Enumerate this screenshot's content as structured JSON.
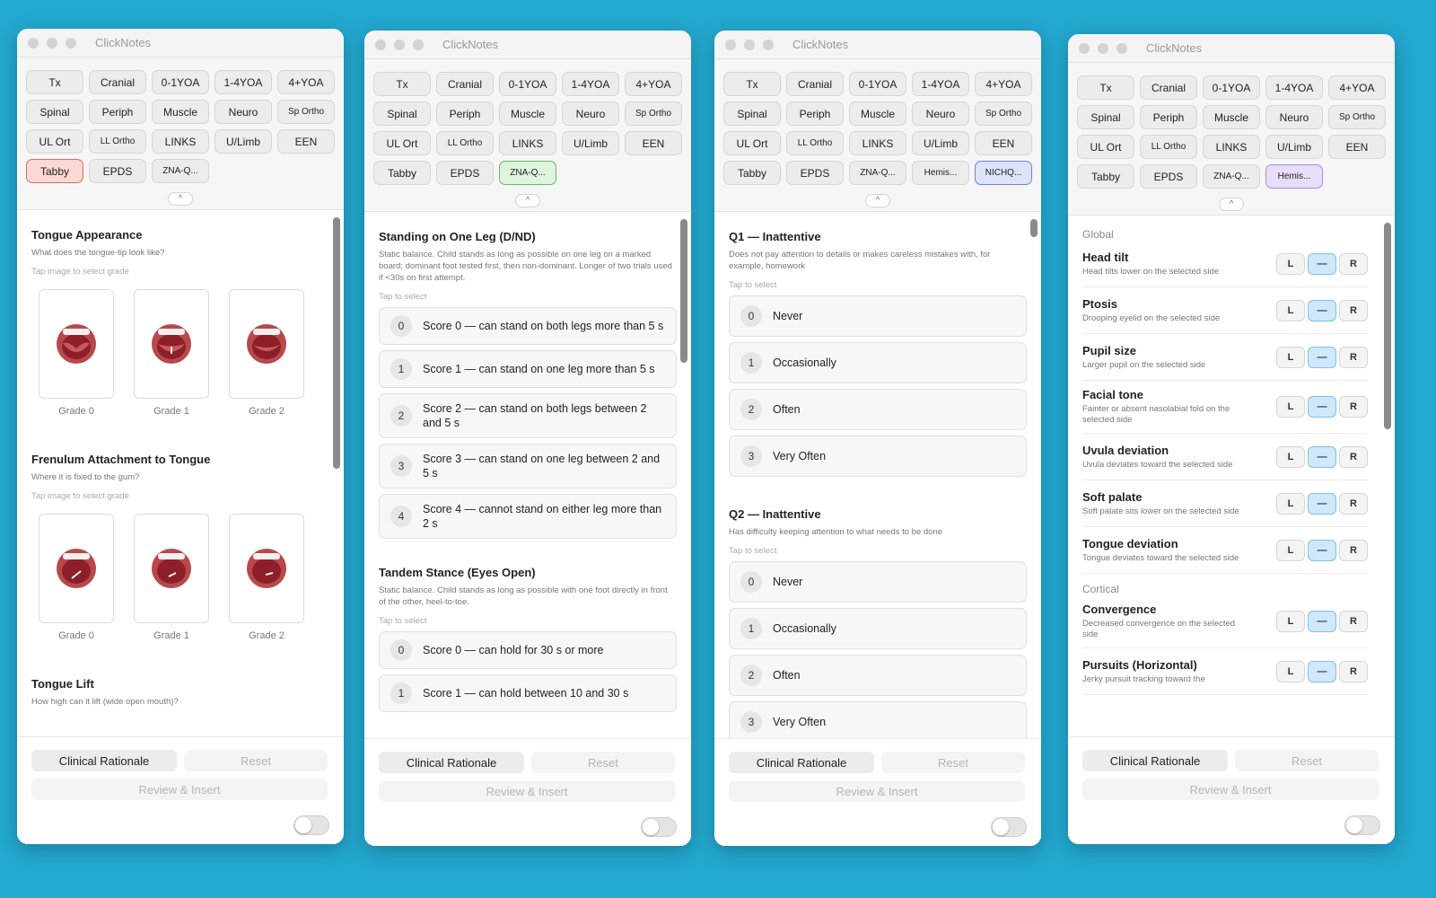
{
  "app_title": "ClickNotes",
  "windows": [
    {
      "tabs": [
        "Tx",
        "Cranial",
        "0-1YOA",
        "1-4YOA",
        "4+YOA",
        "Spinal",
        "Periph",
        "Muscle",
        "Neuro",
        "Sp Ortho",
        "UL Ort",
        "LL Ortho",
        "LINKS",
        "U/Limb",
        "EEN",
        "Tabby",
        "EPDS",
        "ZNA-Q..."
      ],
      "active_tab": "Tabby",
      "sections": [
        {
          "title": "Tongue Appearance",
          "desc": "What does the tongue-tip look like?",
          "tap": "Tap image to select grade",
          "grades": [
            "Grade 0",
            "Grade 1",
            "Grade 2"
          ]
        },
        {
          "title": "Frenulum Attachment to Tongue",
          "desc": "Where it is fixed to the gum?",
          "tap": "Tap image to select grade",
          "grades": [
            "Grade 0",
            "Grade 1",
            "Grade 2"
          ]
        },
        {
          "title": "Tongue Lift",
          "desc": "How high can it lift (wide open mouth)?"
        }
      ]
    },
    {
      "tabs": [
        "Tx",
        "Cranial",
        "0-1YOA",
        "1-4YOA",
        "4+YOA",
        "Spinal",
        "Periph",
        "Muscle",
        "Neuro",
        "Sp Ortho",
        "UL Ort",
        "LL Ortho",
        "LINKS",
        "U/Limb",
        "EEN",
        "Tabby",
        "EPDS",
        "ZNA-Q..."
      ],
      "active_tab": "ZNA-Q...",
      "sections": [
        {
          "title": "Standing on One Leg (D/ND)",
          "desc": "Static balance. Child stands as long as possible on one leg on a marked board; dominant foot tested first, then non-dominant. Longer of two trials used if <30s on first attempt.",
          "tap": "Tap to select",
          "options": [
            {
              "num": "0",
              "text": "Score 0 — can stand on both legs more than 5 s"
            },
            {
              "num": "1",
              "text": "Score 1 — can stand on one leg more than 5 s"
            },
            {
              "num": "2",
              "text": "Score 2 — can stand on both legs between 2 and 5 s"
            },
            {
              "num": "3",
              "text": "Score 3 — can stand on one leg between 2 and 5 s"
            },
            {
              "num": "4",
              "text": "Score 4 — cannot stand on either leg more than 2 s"
            }
          ]
        },
        {
          "title": "Tandem Stance (Eyes Open)",
          "desc": "Static balance. Child stands as long as possible with one foot directly in front of the other, heel-to-toe.",
          "tap": "Tap to select",
          "options": [
            {
              "num": "0",
              "text": "Score 0 — can hold for 30 s or more"
            },
            {
              "num": "1",
              "text": "Score 1 — can hold between 10 and 30 s"
            }
          ]
        }
      ]
    },
    {
      "tabs": [
        "Tx",
        "Cranial",
        "0-1YOA",
        "1-4YOA",
        "4+YOA",
        "Spinal",
        "Periph",
        "Muscle",
        "Neuro",
        "Sp Ortho",
        "UL Ort",
        "LL Ortho",
        "LINKS",
        "U/Limb",
        "EEN",
        "Tabby",
        "EPDS",
        "ZNA-Q...",
        "Hemis...",
        "NICHQ..."
      ],
      "active_tab": "NICHQ...",
      "sections": [
        {
          "title": "Q1 — Inattentive",
          "desc": "Does not pay attention to details or makes careless mistakes with, for example, homework",
          "tap": "Tap to select",
          "options": [
            {
              "num": "0",
              "text": "Never"
            },
            {
              "num": "1",
              "text": "Occasionally"
            },
            {
              "num": "2",
              "text": "Often"
            },
            {
              "num": "3",
              "text": "Very Often"
            }
          ]
        },
        {
          "title": "Q2 — Inattentive",
          "desc": "Has difficulty keeping attention to what needs to be done",
          "tap": "Tap to select",
          "options": [
            {
              "num": "0",
              "text": "Never"
            },
            {
              "num": "1",
              "text": "Occasionally"
            },
            {
              "num": "2",
              "text": "Often"
            },
            {
              "num": "3",
              "text": "Very Often"
            }
          ]
        }
      ]
    },
    {
      "tabs": [
        "Tx",
        "Cranial",
        "0-1YOA",
        "1-4YOA",
        "4+YOA",
        "Spinal",
        "Periph",
        "Muscle",
        "Neuro",
        "Sp Ortho",
        "UL Ort",
        "LL Ortho",
        "LINKS",
        "U/Limb",
        "EEN",
        "Tabby",
        "EPDS",
        "ZNA-Q...",
        "Hemis..."
      ],
      "active_tab": "Hemis...",
      "lr_labels": [
        "L",
        "—",
        "R"
      ],
      "groups": [
        {
          "category": "Global",
          "items": [
            {
              "title": "Head tilt",
              "desc": "Head tilts lower on the selected side"
            },
            {
              "title": "Ptosis",
              "desc": "Drooping eyelid on the selected side"
            },
            {
              "title": "Pupil size",
              "desc": "Larger pupil on the selected side"
            },
            {
              "title": "Facial tone",
              "desc": "Fainter or absent nasolabial fold on the selected side"
            },
            {
              "title": "Uvula deviation",
              "desc": "Uvula deviates toward the selected side"
            },
            {
              "title": "Soft palate",
              "desc": "Soft palate sits lower on the selected side"
            },
            {
              "title": "Tongue deviation",
              "desc": "Tongue deviates toward the selected side"
            }
          ]
        },
        {
          "category": "Cortical",
          "items": [
            {
              "title": "Convergence",
              "desc": "Decreased convergence on the selected side"
            },
            {
              "title": "Pursuits (Horizontal)",
              "desc": "Jerky pursuit tracking toward the"
            }
          ]
        }
      ]
    }
  ],
  "footer": {
    "clinical_rationale": "Clinical Rationale",
    "reset": "Reset",
    "review_insert": "Review & Insert"
  },
  "collapse_glyph": "^",
  "colors": {
    "background": "#23a8cf",
    "tabby_active": "#fbd8d4",
    "zna_active": "#dff3df",
    "nichq_active": "#dde3fb",
    "hemis_active": "#e8ddfb",
    "lr_selected": "#cfe8fb"
  }
}
